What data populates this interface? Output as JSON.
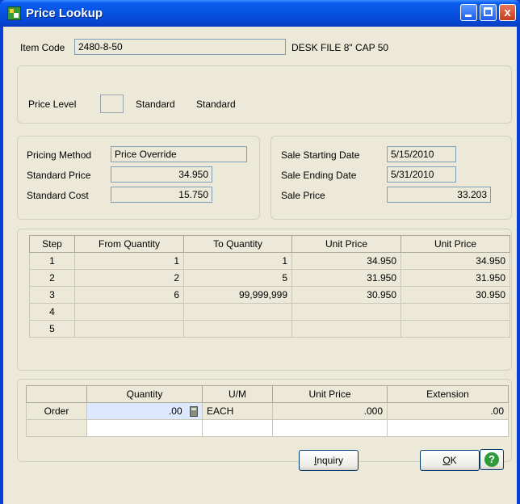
{
  "window": {
    "title": "Price Lookup",
    "close_glyph": "x"
  },
  "item": {
    "code_label": "Item Code",
    "code_value": "2480-8-50",
    "description": "DESK FILE 8\" CAP 50"
  },
  "price_level": {
    "label": "Price Level",
    "value": "",
    "text1": "Standard",
    "text2": "Standard"
  },
  "pricing": {
    "method_label": "Pricing Method",
    "method_value": "Price Override",
    "std_price_label": "Standard Price",
    "std_price_value": "34.950",
    "std_cost_label": "Standard Cost",
    "std_cost_value": "15.750"
  },
  "sale": {
    "start_label": "Sale Starting Date",
    "start_value": "5/15/2010",
    "end_label": "Sale Ending Date",
    "end_value": "5/31/2010",
    "price_label": "Sale Price",
    "price_value": "33.203"
  },
  "price_table": {
    "headers": [
      "Step",
      "From Quantity",
      "To Quantity",
      "Unit Price",
      "Unit Price"
    ],
    "rows": [
      [
        "1",
        "1",
        "1",
        "34.950",
        "34.950"
      ],
      [
        "2",
        "2",
        "5",
        "31.950",
        "31.950"
      ],
      [
        "3",
        "6",
        "99,999,999",
        "30.950",
        "30.950"
      ],
      [
        "4",
        "",
        "",
        "",
        ""
      ],
      [
        "5",
        "",
        "",
        "",
        ""
      ]
    ]
  },
  "order_table": {
    "headers": [
      "",
      "Quantity",
      "U/M",
      "Unit Price",
      "Extension"
    ],
    "row_label": "Order",
    "quantity": ".00",
    "um": "EACH",
    "unit_price": ".000",
    "extension": ".00"
  },
  "buttons": {
    "inquiry_u": "I",
    "inquiry_rest": "nquiry",
    "ok_u": "O",
    "ok_rest": "K",
    "help_glyph": "?"
  },
  "icons": {
    "calculator": "calculator-icon",
    "help": "help-icon",
    "app": "app-icon"
  }
}
